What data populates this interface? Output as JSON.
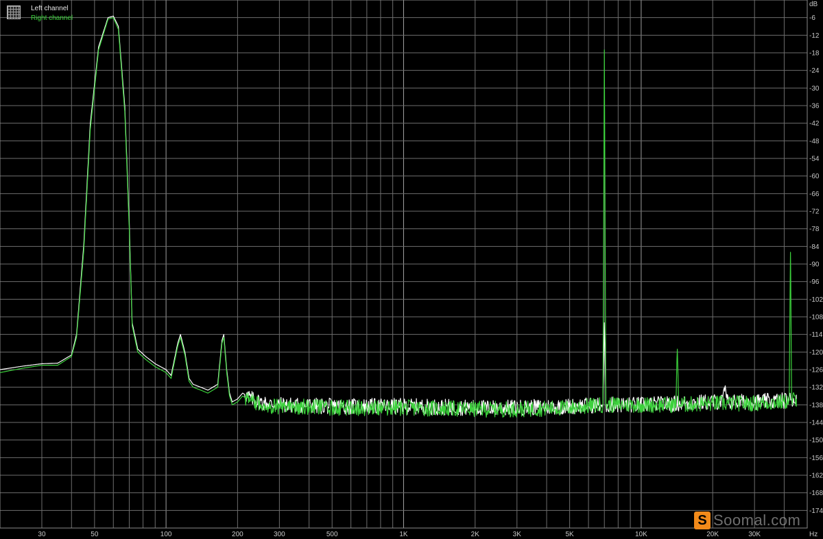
{
  "legend": {
    "icon": "grid-icon",
    "left_label": "Left channel",
    "right_label": "Right channel"
  },
  "watermark": {
    "badge": "S",
    "text": "Soomal.com"
  },
  "chart_data": {
    "type": "line",
    "title": "",
    "xlabel": "Hz",
    "ylabel": "dB",
    "x_scale": "log",
    "xlim": [
      20,
      50000
    ],
    "ylim": [
      -180,
      0
    ],
    "grid": true,
    "legend_position": "top-left",
    "x_ticks": [
      30,
      50,
      100,
      200,
      300,
      500,
      1000,
      2000,
      3000,
      5000,
      10000,
      20000,
      30000
    ],
    "x_tick_labels": [
      "30",
      "50",
      "100",
      "200",
      "300",
      "500",
      "1K",
      "2K",
      "3K",
      "5K",
      "10K",
      "20K",
      "30K"
    ],
    "y_ticks": [
      -6,
      -12,
      -18,
      -24,
      -30,
      -36,
      -42,
      -48,
      -54,
      -60,
      -66,
      -72,
      -78,
      -84,
      -90,
      -96,
      -102,
      -108,
      -114,
      -120,
      -126,
      -132,
      -138,
      -144,
      -150,
      -156,
      -162,
      -168,
      -174
    ],
    "y_tick_labels": [
      "-6",
      "-12",
      "-18",
      "-24",
      "-30",
      "-36",
      "-42",
      "-48",
      "-54",
      "-60",
      "-66",
      "-72",
      "-78",
      "-84",
      "-90",
      "-96",
      "-102",
      "-108",
      "-114",
      "-120",
      "-126",
      "-132",
      "-138",
      "-144",
      "-150",
      "-156",
      "-162",
      "-168",
      "-174"
    ],
    "series": [
      {
        "name": "Left channel",
        "color": "#ffffff",
        "points": [
          [
            20,
            -126
          ],
          [
            25,
            -124.8
          ],
          [
            30,
            -124
          ],
          [
            35,
            -123.8
          ],
          [
            40,
            -121
          ],
          [
            42,
            -114
          ],
          [
            45,
            -84
          ],
          [
            48,
            -42
          ],
          [
            52,
            -16
          ],
          [
            57,
            -6
          ],
          [
            60,
            -5.5
          ],
          [
            63,
            -9
          ],
          [
            67,
            -36
          ],
          [
            70,
            -76
          ],
          [
            72,
            -110
          ],
          [
            76,
            -119
          ],
          [
            82,
            -121.5
          ],
          [
            90,
            -124
          ],
          [
            100,
            -126
          ],
          [
            105,
            -128
          ],
          [
            112,
            -117
          ],
          [
            115,
            -114
          ],
          [
            120,
            -120
          ],
          [
            125,
            -129
          ],
          [
            130,
            -131
          ],
          [
            140,
            -132
          ],
          [
            150,
            -133
          ],
          [
            165,
            -131
          ],
          [
            172,
            -116
          ],
          [
            175,
            -114
          ],
          [
            180,
            -126
          ],
          [
            185,
            -134
          ],
          [
            190,
            -137
          ],
          [
            200,
            -136
          ],
          [
            210,
            -134
          ],
          [
            230,
            -136
          ],
          [
            260,
            -137.5
          ],
          [
            300,
            -138
          ],
          [
            500,
            -138.5
          ],
          [
            1000,
            -138.5
          ],
          [
            2000,
            -139
          ],
          [
            3000,
            -139
          ],
          [
            5000,
            -138.5
          ],
          [
            6900,
            -138
          ],
          [
            7000,
            -110
          ],
          [
            7100,
            -138
          ],
          [
            10000,
            -138
          ],
          [
            15000,
            -137.5
          ],
          [
            20000,
            -137
          ],
          [
            22000,
            -137
          ],
          [
            22500,
            -132
          ],
          [
            23000,
            -137
          ],
          [
            30000,
            -137
          ],
          [
            40000,
            -136.5
          ],
          [
            45000,
            -136
          ]
        ]
      },
      {
        "name": "Right channel",
        "color": "#3cd23c",
        "points": [
          [
            20,
            -127
          ],
          [
            25,
            -125.5
          ],
          [
            30,
            -124.5
          ],
          [
            35,
            -124.5
          ],
          [
            40,
            -121.5
          ],
          [
            42,
            -115
          ],
          [
            45,
            -86
          ],
          [
            48,
            -44
          ],
          [
            52,
            -17
          ],
          [
            57,
            -6.5
          ],
          [
            60,
            -6
          ],
          [
            63,
            -10
          ],
          [
            67,
            -38
          ],
          [
            70,
            -78
          ],
          [
            72,
            -111
          ],
          [
            76,
            -120
          ],
          [
            82,
            -122.5
          ],
          [
            90,
            -125
          ],
          [
            100,
            -127
          ],
          [
            105,
            -129
          ],
          [
            112,
            -118
          ],
          [
            115,
            -115
          ],
          [
            120,
            -121
          ],
          [
            125,
            -130
          ],
          [
            130,
            -132
          ],
          [
            140,
            -133
          ],
          [
            150,
            -134
          ],
          [
            165,
            -132
          ],
          [
            172,
            -117
          ],
          [
            175,
            -115
          ],
          [
            180,
            -127
          ],
          [
            185,
            -135
          ],
          [
            190,
            -138
          ],
          [
            200,
            -137
          ],
          [
            210,
            -135
          ],
          [
            230,
            -137
          ],
          [
            260,
            -138
          ],
          [
            300,
            -138.5
          ],
          [
            500,
            -139
          ],
          [
            1000,
            -139
          ],
          [
            2000,
            -139.5
          ],
          [
            3000,
            -139.5
          ],
          [
            5000,
            -139
          ],
          [
            6900,
            -138
          ],
          [
            7000,
            -17
          ],
          [
            7100,
            -138
          ],
          [
            10000,
            -138
          ],
          [
            14000,
            -138
          ],
          [
            14200,
            -119
          ],
          [
            14400,
            -138
          ],
          [
            20000,
            -137.5
          ],
          [
            30000,
            -137.5
          ],
          [
            40000,
            -137
          ],
          [
            42000,
            -136.5
          ],
          [
            42500,
            -86
          ],
          [
            43000,
            -136.5
          ],
          [
            45000,
            -136
          ]
        ]
      }
    ]
  }
}
